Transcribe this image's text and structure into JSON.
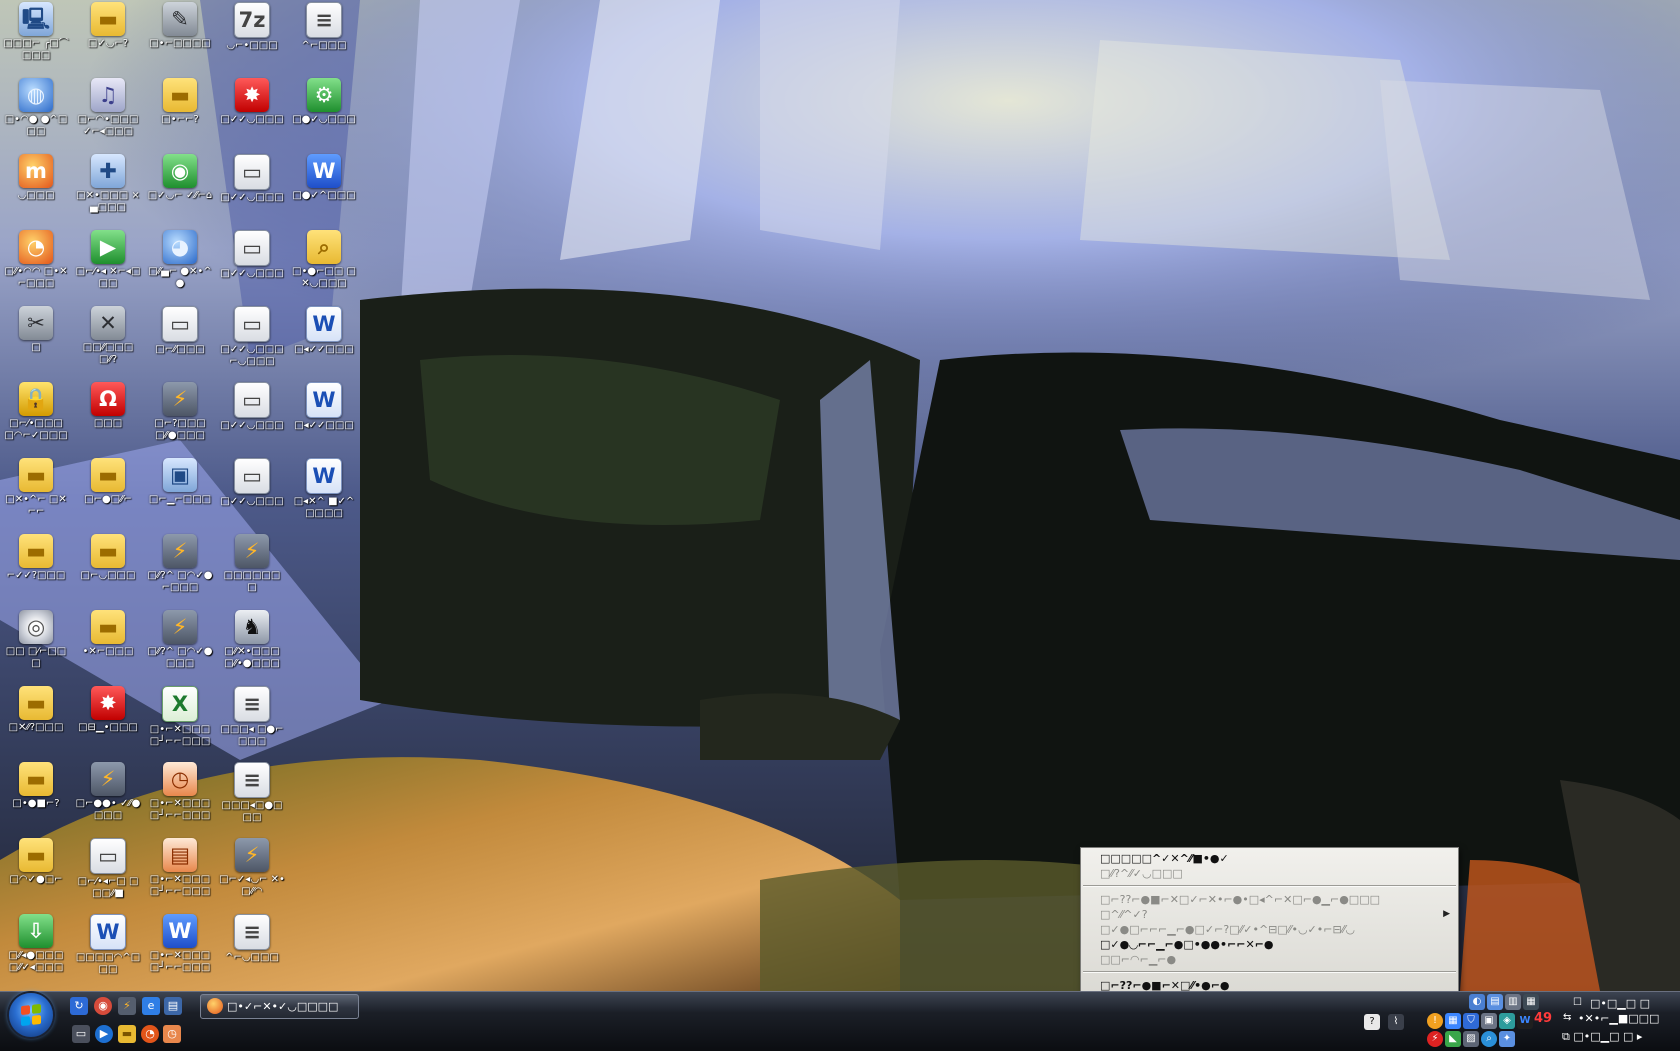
{
  "colors": {
    "taskbar": "#15181f",
    "menu_bg": "#e8e7e2",
    "accent": "#3b86ff"
  },
  "desktop": {
    "icons": [
      {
        "name": "computer",
        "label": "□□□⌐ ╭□⌒□□□",
        "icon": "computer-icon",
        "style": "g-pc",
        "glyph": "🖳"
      },
      {
        "name": "folder-1",
        "label": "□✓◡⌐?",
        "icon": "folder-icon",
        "style": "g-folder",
        "glyph": "▬"
      },
      {
        "name": "syringe-app",
        "label": "□•⌐□□□□",
        "icon": "syringe-icon",
        "style": "g-gear",
        "glyph": "✎"
      },
      {
        "name": "archive-7z",
        "label": "◡⌐•□□□",
        "icon": "archive-icon",
        "style": "g-doc",
        "glyph": "7z"
      },
      {
        "name": "text-file-1",
        "label": "^⌐□□□",
        "icon": "text-file-icon",
        "style": "g-doc",
        "glyph": "≡"
      },
      {
        "name": "network",
        "label": "□•◠● ●^□□□",
        "icon": "network-globe-icon",
        "style": "g-globe",
        "glyph": "◍"
      },
      {
        "name": "media-player",
        "label": "□⌐◠•□□□ ✓⌐◂□□□",
        "icon": "music-note-icon",
        "style": "g-music",
        "glyph": "♫"
      },
      {
        "name": "folder-2",
        "label": "□•⌐⌐?",
        "icon": "folder-icon",
        "style": "g-folder",
        "glyph": "▬"
      },
      {
        "name": "splash-app-1",
        "label": "□✓✓◡□□□",
        "icon": "red-splash-icon",
        "style": "g-red",
        "glyph": "✸"
      },
      {
        "name": "script-file",
        "label": "□●✓◡□□□",
        "icon": "gear-script-icon",
        "style": "g-green",
        "glyph": "⚙"
      },
      {
        "name": "mozbackup",
        "label": "◡□□□",
        "icon": "mozbackup-icon",
        "style": "g-fox",
        "glyph": "m"
      },
      {
        "name": "network-tool",
        "label": "□✕•□□□ ×▄□□□",
        "icon": "network-tool-icon",
        "style": "g-pc",
        "glyph": "✚"
      },
      {
        "name": "green-app",
        "label": "□✓◡⌐ ✓⁄⁄⌐⌂",
        "icon": "green-globe-icon",
        "style": "g-green",
        "glyph": "◉"
      },
      {
        "name": "window-file-1",
        "label": "□✓✓◡□□□",
        "icon": "window-file-icon",
        "style": "g-doc",
        "glyph": "▭"
      },
      {
        "name": "word-w",
        "label": "□●✓^□□□",
        "icon": "word-w-icon",
        "style": "g-blue",
        "glyph": "W"
      },
      {
        "name": "firefox",
        "label": "□⁄⁄•◠◠ □•✕⌐□□□",
        "icon": "firefox-icon",
        "style": "g-fox",
        "glyph": "◔"
      },
      {
        "name": "play-app",
        "label": "□⌐⁄•◂ ✕⌐◂□□□",
        "icon": "play-icon",
        "style": "g-green",
        "glyph": "▶"
      },
      {
        "name": "google-earth",
        "label": "□⁄⁄▄⌐ ●✕•^●",
        "icon": "earth-globe-icon",
        "style": "g-globe",
        "glyph": "◕"
      },
      {
        "name": "window-file-2",
        "label": "□✓✓◡□□□",
        "icon": "window-file-icon",
        "style": "g-doc",
        "glyph": "▭"
      },
      {
        "name": "search-folder",
        "label": "□•●⌐□□ □✕◡□□□",
        "icon": "search-folder-icon",
        "style": "g-folder",
        "glyph": "⌕"
      },
      {
        "name": "tools-app",
        "label": "□",
        "icon": "tools-icon",
        "style": "g-gear",
        "glyph": "✂"
      },
      {
        "name": "tools-shortcut",
        "label": "□□⁄⁄□□□ □⁄⁄?",
        "icon": "wrench-icon",
        "style": "g-gear",
        "glyph": "✕"
      },
      {
        "name": "window-file-3",
        "label": "□⌐⁄⁄□□□",
        "icon": "window-file-icon",
        "style": "g-doc",
        "glyph": "▭"
      },
      {
        "name": "window-file-4",
        "label": "□✓✓◡□□□ ⌐◡□□□",
        "icon": "window-file-icon",
        "style": "g-doc",
        "glyph": "▭"
      },
      {
        "name": "word-doc-1",
        "label": "□◂✓✓□□□",
        "icon": "word-doc-icon",
        "style": "g-word",
        "glyph": "W"
      },
      {
        "name": "lock-app",
        "label": "□⌐⁄•□□□ □◠⌐✓□□□",
        "icon": "lock-icon",
        "style": "g-lock",
        "glyph": "🔒"
      },
      {
        "name": "red-tool",
        "label": "□□□",
        "icon": "red-clamp-icon",
        "style": "g-red",
        "glyph": "Ω"
      },
      {
        "name": "winamp-1",
        "label": "□⌐?□□□ □⁄⁄●□□□",
        "icon": "lightning-icon",
        "style": "g-zap",
        "glyph": "⚡"
      },
      {
        "name": "window-file-5",
        "label": "□✓✓◡□□□",
        "icon": "window-file-icon",
        "style": "g-doc",
        "glyph": "▭"
      },
      {
        "name": "word-doc-2",
        "label": "□◂✓✓□□□",
        "icon": "word-doc-icon",
        "style": "g-word",
        "glyph": "W"
      },
      {
        "name": "folder-3",
        "label": "□✕•^⌐ □✕⌐⌐",
        "icon": "folder-icon",
        "style": "g-folder",
        "glyph": "▬"
      },
      {
        "name": "folder-4",
        "label": "□⌐●□⁄⁄⌐",
        "icon": "folder-icon",
        "style": "g-folder",
        "glyph": "▬"
      },
      {
        "name": "monitor-app",
        "label": "□⌐▁⌐□□□",
        "icon": "monitor-icon",
        "style": "g-pc",
        "glyph": "▣"
      },
      {
        "name": "window-file-6",
        "label": "□✓✓◡□□□",
        "icon": "window-file-icon",
        "style": "g-doc",
        "glyph": "▭"
      },
      {
        "name": "word-doc-3",
        "label": "□◂✕^ ■✓^□□□□",
        "icon": "word-doc-icon",
        "style": "g-word",
        "glyph": "W"
      },
      {
        "name": "folder-5",
        "label": "⌐✓✓?□□□",
        "icon": "folder-icon",
        "style": "g-folder",
        "glyph": "▬"
      },
      {
        "name": "folder-6",
        "label": "□⌐◡□□□",
        "icon": "folder-icon",
        "style": "g-folder",
        "glyph": "▬"
      },
      {
        "name": "winamp-2",
        "label": "□⁄⁄?^ □◠✓●⌐□□□",
        "icon": "lightning-icon",
        "style": "g-zap",
        "glyph": "⚡"
      },
      {
        "name": "winamp-3",
        "label": "□□□□□□□",
        "icon": "lightning-icon",
        "style": "g-zap",
        "glyph": "⚡"
      },
      {
        "name": "cd-drive",
        "label": "□□ □⁄⌐□□□",
        "icon": "disc-icon",
        "style": "g-disc",
        "glyph": "◎"
      },
      {
        "name": "folder-7",
        "label": "•✕⌐□□□",
        "icon": "folder-icon",
        "style": "g-folder",
        "glyph": "▬"
      },
      {
        "name": "winamp-4",
        "label": "□⁄⁄?^ □◠✓●□□□",
        "icon": "lightning-icon",
        "style": "g-zap",
        "glyph": "⚡"
      },
      {
        "name": "counter-strike",
        "label": "□⁄⁄✕•□□□ □⁄⁄•●□□□",
        "icon": "counter-strike-icon",
        "style": "g-cs",
        "glyph": "♞"
      },
      {
        "name": "folder-8",
        "label": "□✕⁄⁄?□□□",
        "icon": "folder-icon",
        "style": "g-folder",
        "glyph": "▬"
      },
      {
        "name": "splash-app-2",
        "label": "□⊟▁•□□□",
        "icon": "red-splash-icon",
        "style": "g-red",
        "glyph": "✸"
      },
      {
        "name": "excel-doc",
        "label": "□•⌐✕□□□ □┘⌐⌐□□□",
        "icon": "excel-icon",
        "style": "g-excel",
        "glyph": "X"
      },
      {
        "name": "text-file-2",
        "label": "□□□◂ □●⌐□□□",
        "icon": "text-file-icon",
        "style": "g-doc",
        "glyph": "≡"
      },
      {
        "name": "folder-9",
        "label": "□•●■⌐?",
        "icon": "folder-icon",
        "style": "g-folder",
        "glyph": "▬"
      },
      {
        "name": "winamp-5",
        "label": "□⌐●●• ✓⁄⁄●□□□",
        "icon": "lightning-icon",
        "style": "g-zap",
        "glyph": "⚡"
      },
      {
        "name": "clock-app",
        "label": "□•⌐✕□□□ □┘⌐⌐□□□",
        "icon": "clock-slide-icon",
        "style": "g-slide",
        "glyph": "◷"
      },
      {
        "name": "text-file-3",
        "label": "□□□◂□●□□□",
        "icon": "text-file-icon",
        "style": "g-doc",
        "glyph": "≡"
      },
      {
        "name": "folder-10",
        "label": "□◠✓●□⌐",
        "icon": "folder-icon",
        "style": "g-folder",
        "glyph": "▬"
      },
      {
        "name": "window-file-7",
        "label": "□⌐⁄•◂⌐□ □□□⁄⁄■",
        "icon": "window-file-icon",
        "style": "g-doc",
        "glyph": "▭"
      },
      {
        "name": "slide-doc",
        "label": "□•⌐✕□□□ □┘⌐⌐□□□",
        "icon": "slide-icon",
        "style": "g-slide",
        "glyph": "▤"
      },
      {
        "name": "winamp-6",
        "label": "□⌐✓◂◡⌐ ✕•□⁄⁄◠",
        "icon": "lightning-icon",
        "style": "g-zap",
        "glyph": "⚡"
      },
      {
        "name": "download-app",
        "label": "□⁄⁄◂●□□□ □⁄⁄✓◂□□□",
        "icon": "green-down-arrow-icon",
        "style": "g-green",
        "glyph": "⇩"
      },
      {
        "name": "word-doc-4",
        "label": "□□□□◠^□□□",
        "icon": "word-doc-icon",
        "style": "g-word",
        "glyph": "W"
      },
      {
        "name": "word-doc-5",
        "label": "□•⌐✕□□□ □┘⌐⌐□□□",
        "icon": "word-doc-icon",
        "style": "g-blue",
        "glyph": "W"
      },
      {
        "name": "text-file-4",
        "label": "^⌐◡□□□",
        "icon": "text-file-icon",
        "style": "g-doc",
        "glyph": "≡"
      }
    ]
  },
  "context_menu": {
    "items": [
      {
        "label": "□□□□□^✓✕^⁄⁄■•●✓",
        "bold": true,
        "disabled": false,
        "submenu": false
      },
      {
        "label": "□⁄⁄?^⁄⁄✓◡□□□",
        "bold": false,
        "disabled": true,
        "submenu": false
      },
      {
        "sep": true
      },
      {
        "label": "□⌐??⌐●■⌐✕□✓⌐✕•⌐●•□◂^⌐✕□⌐●▁⌐●□□□",
        "bold": false,
        "disabled": true,
        "submenu": false
      },
      {
        "label": "□^⁄⁄^✓?",
        "bold": false,
        "disabled": true,
        "submenu": true
      },
      {
        "label": "□✓●□⌐⌐⌐▁⌐●□✓⌐?□⁄⁄✓•^⊟□⁄⁄•◡✓•⌐⊟⁄⁄◡",
        "bold": false,
        "disabled": true,
        "submenu": false
      },
      {
        "label": "□✓●◡⌐⌐▁⌐●□•●●•⌐⌐✕⌐●",
        "bold": true,
        "disabled": false,
        "submenu": false
      },
      {
        "label": "□□⌐◠⌐▁⌐●",
        "bold": false,
        "disabled": true,
        "submenu": false
      },
      {
        "sep": true
      },
      {
        "label": "□⌐??⌐●■⌐✕□⁄⁄•●⌐●",
        "bold": true,
        "disabled": false,
        "submenu": false
      },
      {
        "label": "□▁?◠⁄⁄•^⌐●",
        "bold": true,
        "disabled": false,
        "submenu": false
      }
    ]
  },
  "taskbar": {
    "task_button_label": "□•✓⌐✕•✓◡□□□□",
    "tray_number": "49",
    "clock_top": "□•□▁□ □",
    "clock_bottom": "•✕•⌐▁■□□□"
  }
}
